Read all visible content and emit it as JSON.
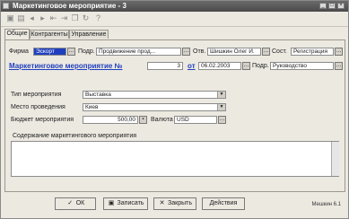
{
  "window": {
    "title": "Маркетинговое мероприятие - 3"
  },
  "toolbar": {
    "icons": [
      "save-icon",
      "print-icon",
      "previous-icon",
      "next-icon",
      "first-icon",
      "last-icon",
      "copy-icon",
      "refresh-icon",
      "help-icon"
    ]
  },
  "tabs": [
    {
      "label": "Общие"
    },
    {
      "label": "Контрагенты"
    },
    {
      "label": "Управление"
    }
  ],
  "form": {
    "firma_label": "Фирма",
    "firma_value": "Эскорт",
    "podr_label": "Подр.",
    "podr_value": "Продвижение прод...",
    "otv_label": "Отв.",
    "otv_value": "Шишкин Олег И.",
    "sost_label": "Сост.",
    "sost_value": "Регистрация",
    "doc_title": "Маркетинговое мероприятие №",
    "doc_number": "3",
    "ot_label": "от",
    "doc_date": "06.02.2003",
    "podr2_label": "Подр.",
    "podr2_value": "Руководство",
    "type_label": "Тип мероприятия",
    "type_value": "Выставка",
    "place_label": "Место проведения",
    "place_value": "Киев",
    "budget_label": "Бюджет мероприятия",
    "budget_value": "500,00",
    "currency_label": "Валюта",
    "currency_value": "USD",
    "content_label": "Содержание маркетингового мероприятия",
    "content_value": ""
  },
  "buttons": {
    "ok": "ОК",
    "save": "Записать",
    "close": "Закрыть",
    "actions": "Действия"
  },
  "version": "Мешкин 6.1"
}
